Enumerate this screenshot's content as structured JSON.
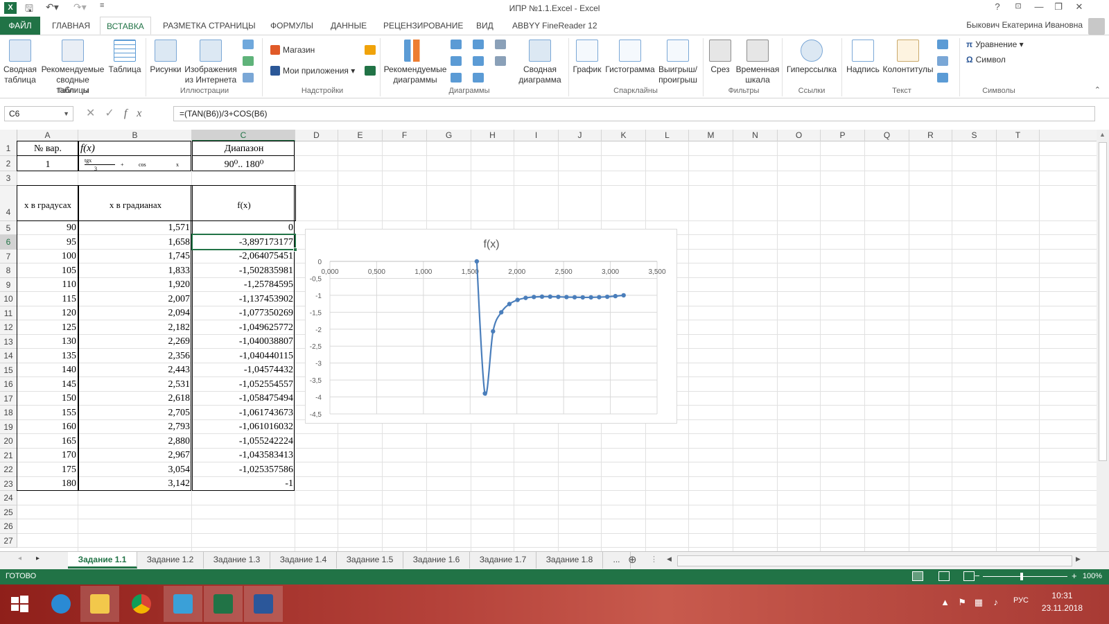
{
  "window": {
    "title": "ИПР №1.1.Excel - Excel",
    "app_icon": "X",
    "help": "?",
    "min": "—",
    "max": "❐",
    "close": "✕"
  },
  "ribbon_tabs": [
    "ФАЙЛ",
    "ГЛАВНАЯ",
    "ВСТАВКА",
    "РАЗМЕТКА СТРАНИЦЫ",
    "ФОРМУЛЫ",
    "ДАННЫЕ",
    "РЕЦЕНЗИРОВАНИЕ",
    "ВИД",
    "ABBYY FineReader 12"
  ],
  "active_tab": "ВСТАВКА",
  "user": "Быкович Екатерина Ивановна",
  "ribbon": {
    "pivot_table": [
      "Сводная",
      "таблица"
    ],
    "recommended_pivot": [
      "Рекомендуемые",
      "сводные таблицы"
    ],
    "table": "Таблица",
    "group_tables": "Таблицы",
    "pictures": "Рисунки",
    "online_pictures": [
      "Изображения",
      "из Интернета"
    ],
    "group_illustrations": "Иллюстрации",
    "store": "Магазин",
    "my_apps": "Мои приложения",
    "group_addins": "Надстройки",
    "recommended_charts": [
      "Рекомендуемые",
      "диаграммы"
    ],
    "pivot_chart": [
      "Сводная",
      "диаграмма"
    ],
    "group_charts": "Диаграммы",
    "sparkline_line": "График",
    "sparkline_column": "Гистограмма",
    "sparkline_winloss": [
      "Выигрыш/",
      "проигрыш"
    ],
    "group_sparklines": "Спарклайны",
    "slicer": "Срез",
    "timeline": [
      "Временная",
      "шкала"
    ],
    "group_filters": "Фильтры",
    "hyperlink": "Гиперссылка",
    "group_links": "Ссылки",
    "textbox": "Надпись",
    "header_footer": "Колонтитулы",
    "group_text": "Текст",
    "equation": "Уравнение",
    "symbol": "Символ",
    "group_symbols": "Символы"
  },
  "formula_bar": {
    "name_box": "C6",
    "formula": "=(TAN(B6))/3+COS(B6)"
  },
  "columns": [
    "A",
    "B",
    "C",
    "D",
    "E",
    "F",
    "G",
    "H",
    "I",
    "J",
    "K",
    "L",
    "M",
    "N",
    "O",
    "P",
    "Q",
    "R",
    "S",
    "T"
  ],
  "rows": [
    "1",
    "2",
    "3",
    "4",
    "5",
    "6",
    "7",
    "8",
    "9",
    "10",
    "11",
    "12",
    "13",
    "14",
    "15",
    "16",
    "17",
    "18",
    "19",
    "20",
    "21",
    "22",
    "23",
    "24",
    "25",
    "26",
    "27"
  ],
  "header_cells": {
    "a1": "№ вар.",
    "b1": "f(x)",
    "c1": "Диапазон",
    "a2": "1",
    "b2_num": "tgx",
    "b2_den": "3",
    "b2_plus": "+",
    "b2_cos": "cos",
    "b2_x": "x",
    "c2": "90⁰.. 180⁰",
    "a4": "x в градусах",
    "b4": "x в градианах",
    "c4": "f(x)"
  },
  "table_rows": [
    [
      "90",
      "1,571",
      "0"
    ],
    [
      "95",
      "1,658",
      "-3,897173177"
    ],
    [
      "100",
      "1,745",
      "-2,064075451"
    ],
    [
      "105",
      "1,833",
      "-1,502835981"
    ],
    [
      "110",
      "1,920",
      "-1,25784595"
    ],
    [
      "115",
      "2,007",
      "-1,137453902"
    ],
    [
      "120",
      "2,094",
      "-1,077350269"
    ],
    [
      "125",
      "2,182",
      "-1,049625772"
    ],
    [
      "130",
      "2,269",
      "-1,040038807"
    ],
    [
      "135",
      "2,356",
      "-1,040440115"
    ],
    [
      "140",
      "2,443",
      "-1,04574432"
    ],
    [
      "145",
      "2,531",
      "-1,052554557"
    ],
    [
      "150",
      "2,618",
      "-1,058475494"
    ],
    [
      "155",
      "2,705",
      "-1,061743673"
    ],
    [
      "160",
      "2,793",
      "-1,061016032"
    ],
    [
      "165",
      "2,880",
      "-1,055242224"
    ],
    [
      "170",
      "2,967",
      "-1,043583413"
    ],
    [
      "175",
      "3,054",
      "-1,025357586"
    ],
    [
      "180",
      "3,142",
      "-1"
    ]
  ],
  "chart_data": {
    "type": "scatter",
    "title": "f(x)",
    "x_tick_labels": [
      "0,000",
      "0,500",
      "1,000",
      "1,500",
      "2,000",
      "2,500",
      "3,000",
      "3,500"
    ],
    "y_tick_labels": [
      "0",
      "-0,5",
      "-1",
      "-1,5",
      "-2",
      "-2,5",
      "-3",
      "-3,5",
      "-4",
      "-4,5"
    ],
    "xlim": [
      0,
      3.5
    ],
    "ylim": [
      -4.5,
      0
    ],
    "x": [
      1.571,
      1.658,
      1.745,
      1.833,
      1.92,
      2.007,
      2.094,
      2.182,
      2.269,
      2.356,
      2.443,
      2.531,
      2.618,
      2.705,
      2.793,
      2.88,
      2.967,
      3.054,
      3.142
    ],
    "y": [
      0,
      -3.897,
      -2.064,
      -1.503,
      -1.258,
      -1.137,
      -1.077,
      -1.05,
      -1.04,
      -1.04,
      -1.046,
      -1.053,
      -1.058,
      -1.062,
      -1.061,
      -1.055,
      -1.044,
      -1.025,
      -1.0
    ],
    "grid": true,
    "smooth_line": true,
    "series_color": "#4a7ebb"
  },
  "sheets": [
    "Задание 1.1",
    "Задание 1.2",
    "Задание 1.3",
    "Задание 1.4",
    "Задание 1.5",
    "Задание 1.6",
    "Задание 1.7",
    "Задание 1.8",
    "..."
  ],
  "active_sheet": "Задание 1.1",
  "status": {
    "ready": "ГОТОВО",
    "zoom": "100%"
  },
  "taskbar": {
    "lang": "РУС",
    "time": "10:31",
    "date": "23.11.2018"
  },
  "colors": {
    "excel_green": "#217346",
    "taskbar_red": "#b5423a"
  }
}
